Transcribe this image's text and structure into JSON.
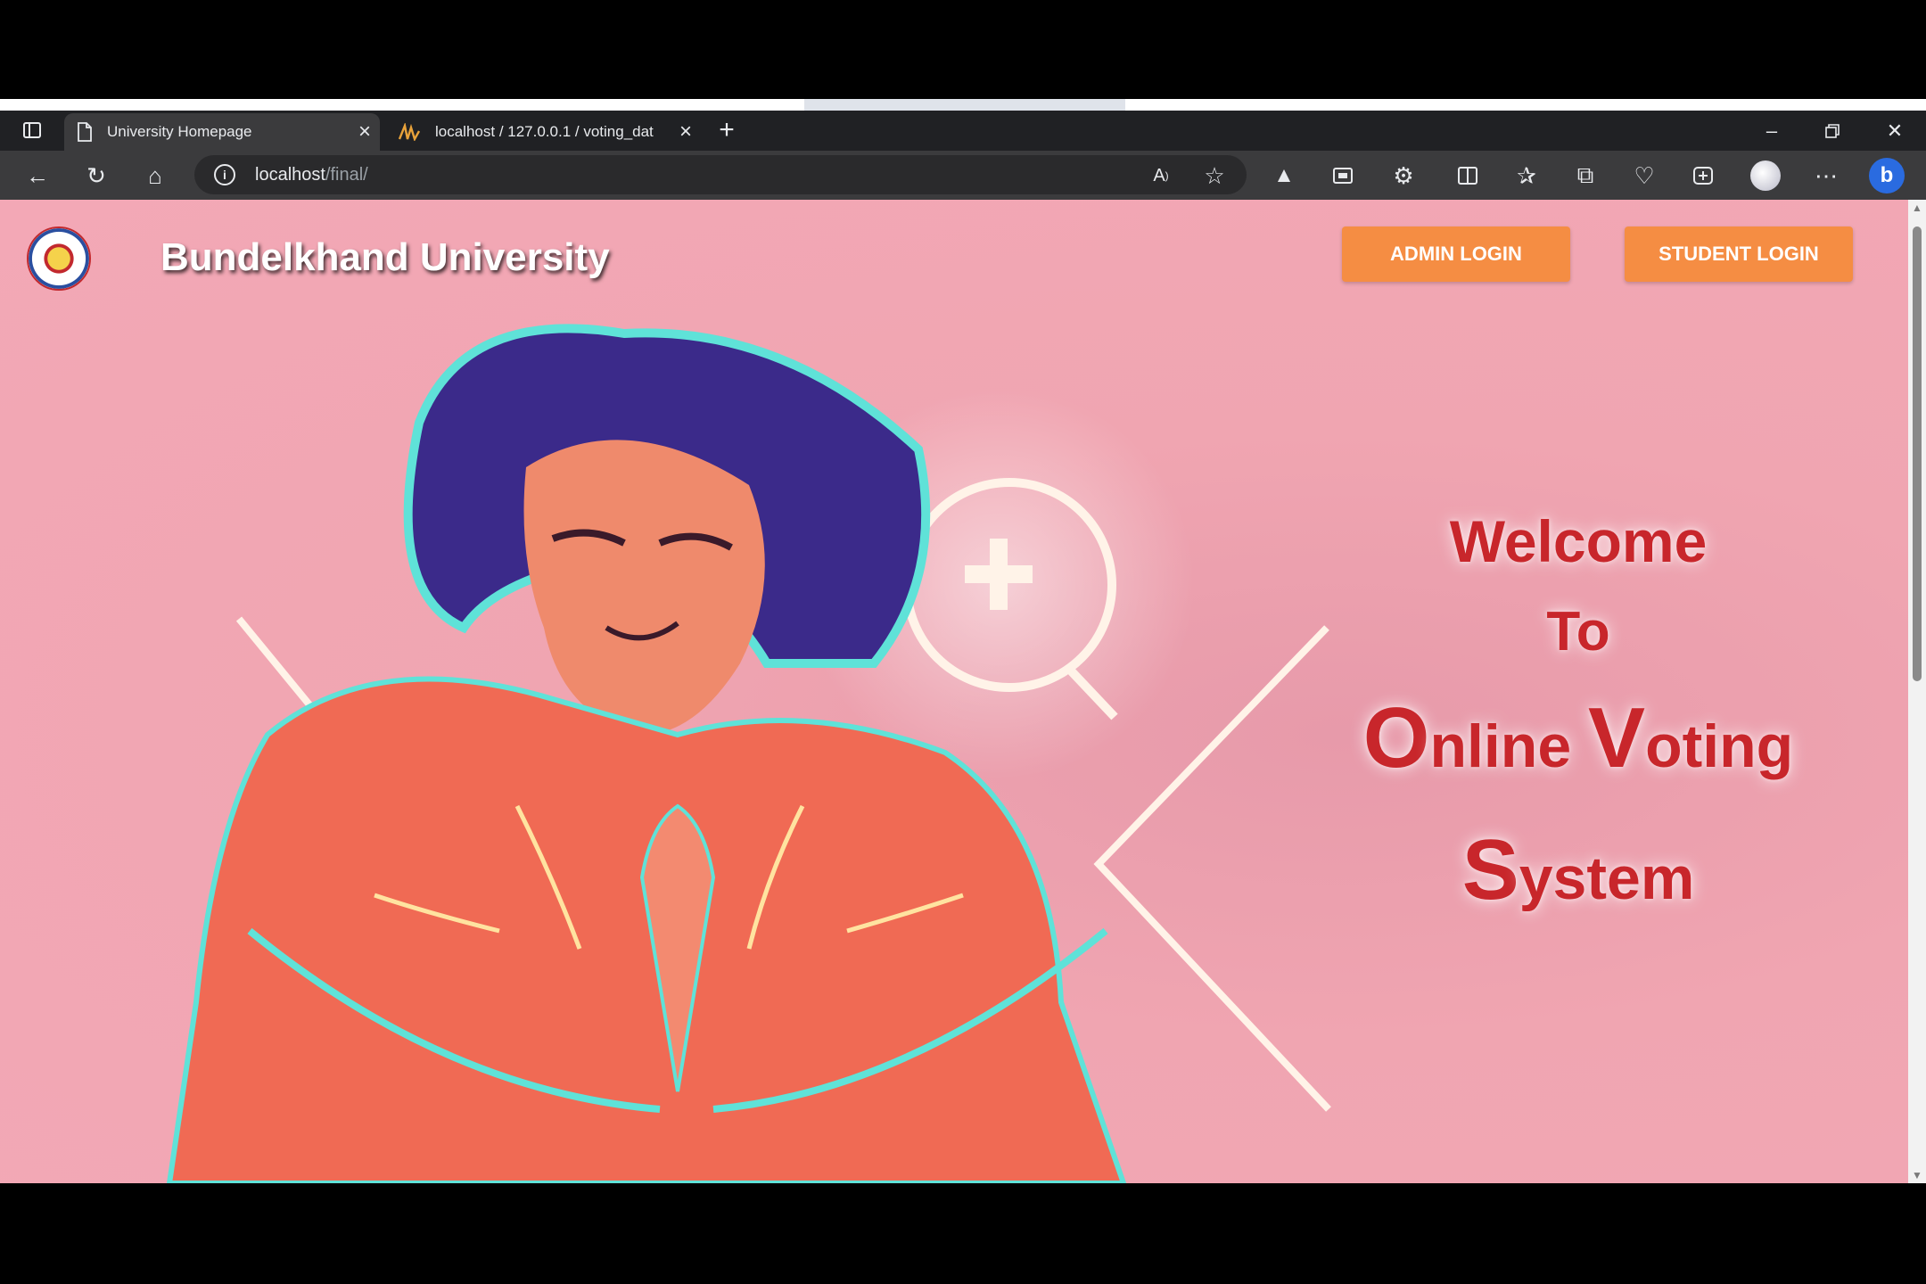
{
  "browser": {
    "tabs": [
      {
        "title": "University Homepage",
        "active": true
      },
      {
        "title": "localhost / 127.0.0.1 / voting_dat",
        "active": false
      }
    ],
    "new_tab_label": "+",
    "address": {
      "host": "localhost",
      "path": "/final/"
    }
  },
  "page": {
    "university_name": "Bundelkhand University",
    "admin_login": "ADMIN LOGIN",
    "student_login": "STUDENT LOGIN",
    "welcome": {
      "line1": "Welcome",
      "line2": "To",
      "line3": [
        {
          "cap": "O",
          "rest": "nline "
        },
        {
          "cap": "V",
          "rest": "oting"
        }
      ],
      "line4": [
        {
          "cap": "S",
          "rest": "ystem"
        }
      ]
    }
  },
  "colors": {
    "page_bg": "#f3a8b6",
    "button": "#f58d43",
    "welcome_text": "#c8262b"
  }
}
